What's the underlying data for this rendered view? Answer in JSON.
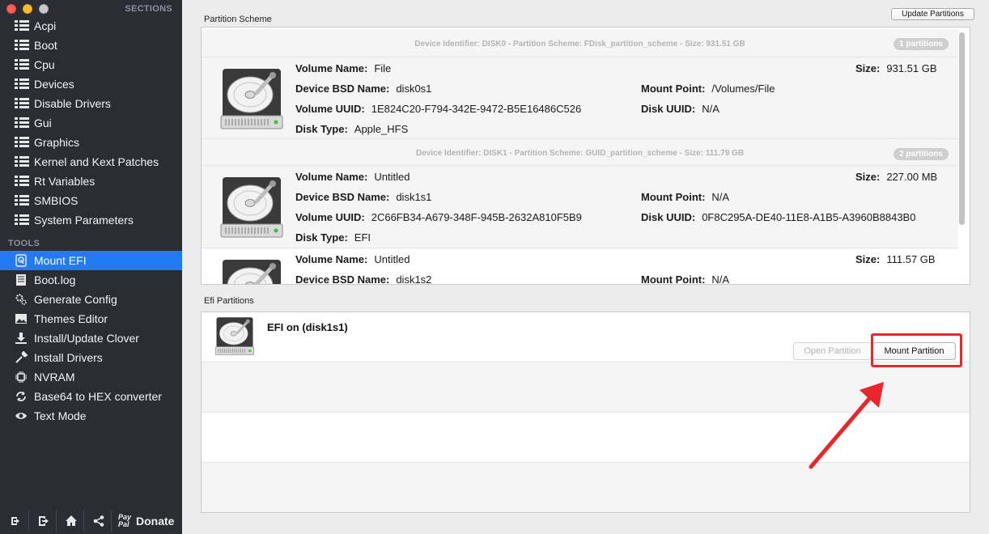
{
  "sidebar": {
    "sections_header": "SECTIONS",
    "sections": [
      {
        "label": "Acpi",
        "icon": "list-icon"
      },
      {
        "label": "Boot",
        "icon": "list-icon"
      },
      {
        "label": "Cpu",
        "icon": "list-icon"
      },
      {
        "label": "Devices",
        "icon": "list-icon"
      },
      {
        "label": "Disable Drivers",
        "icon": "list-icon"
      },
      {
        "label": "Gui",
        "icon": "list-icon"
      },
      {
        "label": "Graphics",
        "icon": "list-icon"
      },
      {
        "label": "Kernel and Kext Patches",
        "icon": "list-icon"
      },
      {
        "label": "Rt Variables",
        "icon": "list-icon"
      },
      {
        "label": "SMBIOS",
        "icon": "list-icon"
      },
      {
        "label": "System Parameters",
        "icon": "list-icon"
      }
    ],
    "tools_header": "TOOLS",
    "tools": [
      {
        "label": "Mount EFI",
        "icon": "disk-icon",
        "active": true
      },
      {
        "label": "Boot.log",
        "icon": "log-icon"
      },
      {
        "label": "Generate Config",
        "icon": "gears-icon"
      },
      {
        "label": "Themes Editor",
        "icon": "image-icon"
      },
      {
        "label": "Install/Update Clover",
        "icon": "download-icon"
      },
      {
        "label": "Install Drivers",
        "icon": "wrench-icon"
      },
      {
        "label": "NVRAM",
        "icon": "chip-icon"
      },
      {
        "label": "Base64 to HEX converter",
        "icon": "convert-icon"
      },
      {
        "label": "Text Mode",
        "icon": "eye-icon"
      }
    ],
    "bottom": {
      "paypal_line1": "Pay",
      "paypal_line2": "Pal",
      "donate_label": "Donate"
    }
  },
  "main": {
    "partition_scheme_label": "Partition Scheme",
    "update_button": "Update Partitions",
    "disks": [
      {
        "header": "Device Identifier: DISK0 - Partition Scheme: FDisk_partition_scheme - Size: 931.51 GB",
        "badge": "1 partitions",
        "partitions": [
          {
            "volume_name": "File",
            "bsd_name": "disk0s1",
            "uuid": "1E824C20-F794-342E-9472-B5E16486C526",
            "disk_type": "Apple_HFS",
            "size": "931.51 GB",
            "mount_point": "/Volumes/File",
            "disk_uuid": "N/A"
          }
        ]
      },
      {
        "header": "Device Identifier: DISK1 - Partition Scheme: GUID_partition_scheme - Size: 111.79 GB",
        "badge": "2 partitions",
        "partitions": [
          {
            "volume_name": "Untitled",
            "bsd_name": "disk1s1",
            "uuid": "2C66FB34-A679-348F-945B-2632A810F5B9",
            "disk_type": "EFI",
            "size": "227.00 MB",
            "mount_point": "N/A",
            "disk_uuid": "0F8C295A-DE40-11E8-A1B5-A3960B8843B0"
          },
          {
            "volume_name": "Untitled",
            "bsd_name": "disk1s2",
            "size": "111.57 GB",
            "mount_point": "N/A"
          }
        ]
      }
    ],
    "labels": {
      "volume_name": "Volume Name:",
      "bsd_name": "Device BSD Name:",
      "uuid": "Volume UUID:",
      "disk_type": "Disk Type:",
      "size": "Size:",
      "mount_point": "Mount Point:",
      "disk_uuid": "Disk UUID:"
    },
    "efi_partitions_label": "Efi Partitions",
    "efi": {
      "title": "EFI on  (disk1s1)",
      "open_button": "Open Partition",
      "mount_button": "Mount Partition"
    }
  },
  "colors": {
    "sidebar_bg": "#2b2d35",
    "active_item": "#1f7cf4",
    "highlight": "#e8262b"
  }
}
